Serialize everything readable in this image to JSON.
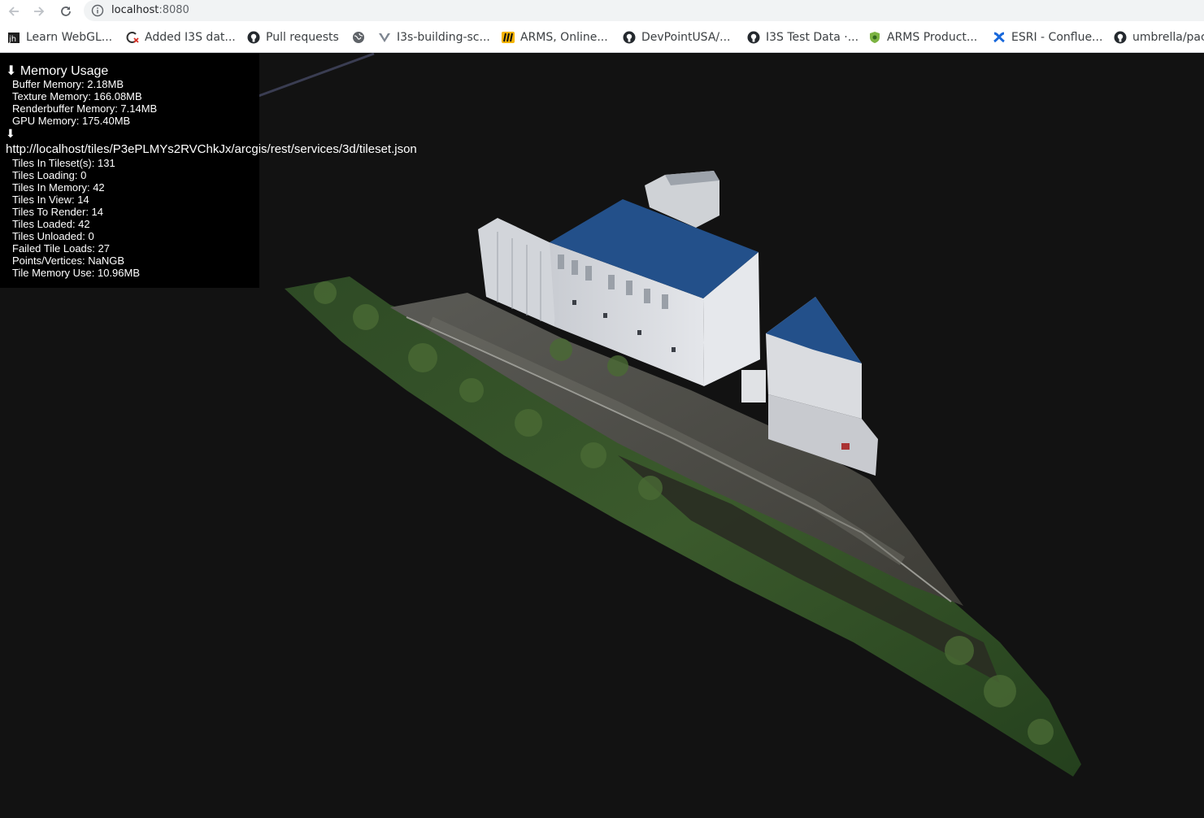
{
  "browser": {
    "address": {
      "host": "localhost",
      "port": ":8080"
    },
    "bookmarks": [
      {
        "label": "Learn WebGL...",
        "icon": "jh-favicon"
      },
      {
        "label": "Added I3S dat...",
        "icon": "broken-build-favicon"
      },
      {
        "label": "Pull requests",
        "icon": "github-icon"
      },
      {
        "label": "",
        "icon": "globe-icon"
      },
      {
        "label": "I3s-building-sc...",
        "icon": "v-favicon"
      },
      {
        "label": "ARMS, Online...",
        "icon": "arms-favicon"
      },
      {
        "label": "DevPointUSA/...",
        "icon": "github-icon"
      },
      {
        "label": "I3S Test Data ·...",
        "icon": "github-icon"
      },
      {
        "label": "ARMS Product...",
        "icon": "shield-favicon"
      },
      {
        "label": "ESRI - Conflue...",
        "icon": "confluence-icon"
      },
      {
        "label": "umbrella/pac",
        "icon": "github-icon"
      }
    ]
  },
  "stats": {
    "memory_header": "⬇ Memory Usage",
    "memory": [
      "Buffer Memory: 2.18MB",
      "Texture Memory: 166.08MB",
      "Renderbuffer Memory: 7.14MB",
      "GPU Memory: 175.40MB"
    ],
    "tileset_arrow": "⬇",
    "tileset_url": "http://localhost/tiles/P3ePLMYs2RVChkJx/arcgis/rest/services/3d/tileset.json",
    "tileset": [
      "Tiles In Tileset(s): 131",
      "Tiles Loading: 0",
      "Tiles In Memory: 42",
      "Tiles In View: 14",
      "Tiles To Render: 14",
      "Tiles Loaded: 42",
      "Tiles Unloaded: 0",
      "Failed Tile Loads: 27",
      "Points/Vertices: NaNGB",
      "Tile Memory Use: 10.96MB"
    ]
  },
  "colors": {
    "viewport_bg": "#121212",
    "roof_blue": "#23508a",
    "wall_white": "#d8dbe0",
    "vegetation": "#2f4a22"
  }
}
